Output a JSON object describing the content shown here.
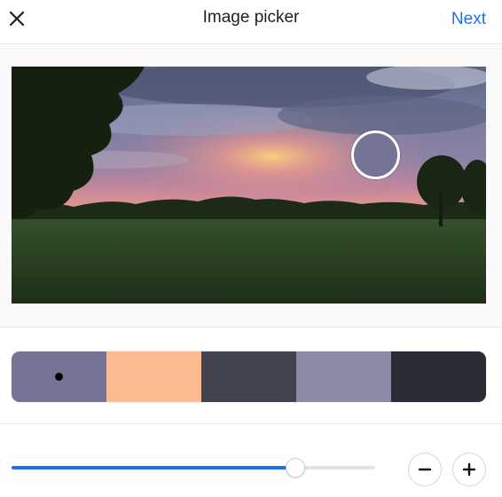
{
  "header": {
    "title": "Image picker",
    "next_label": "Next",
    "close_icon": "close-icon"
  },
  "photo": {
    "description_icon": "photo",
    "picked_color": "#757396"
  },
  "palette": {
    "swatches": [
      {
        "color": "#757396",
        "selected": true
      },
      {
        "color": "#fbba91",
        "selected": false
      },
      {
        "color": "#41444f",
        "selected": false
      },
      {
        "color": "#8b8ba6",
        "selected": false
      },
      {
        "color": "#292d33",
        "selected": false
      }
    ]
  },
  "slider": {
    "value_fraction": 0.78,
    "accent_color": "#1a73e8",
    "minus_icon": "minus-icon",
    "plus_icon": "plus-icon"
  }
}
